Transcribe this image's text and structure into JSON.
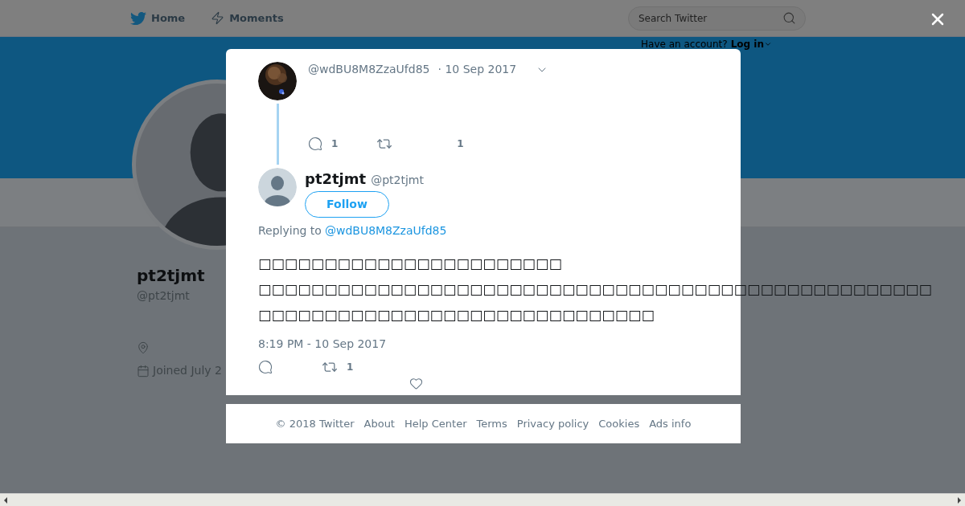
{
  "header": {
    "nav": [
      {
        "label": "Home",
        "kind": "home"
      },
      {
        "label": "Moments",
        "kind": "moments"
      }
    ],
    "search": {
      "placeholder": "Search Twitter"
    },
    "login_prompt": {
      "text": "Have an account?",
      "link": "Log in"
    }
  },
  "profile": {
    "name": "pt2tjmt",
    "handle": "@pt2tjmt",
    "joined": "Joined July 2"
  },
  "modal": {
    "parent_tweet": {
      "handle": "@wdBU8M8ZzaUfd85",
      "date": "· 10 Sep 2017",
      "reply_count": "1",
      "like_count": "1"
    },
    "tweet": {
      "name": "pt2tjmt",
      "handle": "@pt2tjmt",
      "follow": "Follow",
      "replying_label": "Replying to",
      "replying_to": "@wdBU8M8ZzaUfd85",
      "text_lines": [
        "□□□□□□□□□□□□□□□□□□□□□□□",
        "□□□□□□□□□□□□□□□□□□□□□□□□□□□□□□□□□□□□□□□□□□□□□□□□□□□",
        "□□□□□□□□□□□□□□□□□□□□□□□□□□□□□□"
      ],
      "timestamp": "8:19 PM - 10 Sep 2017",
      "retweet_count": "1"
    }
  },
  "footer": {
    "links": [
      "© 2018 Twitter",
      "About",
      "Help Center",
      "Terms",
      "Privacy policy",
      "Cookies",
      "Ads info"
    ]
  }
}
